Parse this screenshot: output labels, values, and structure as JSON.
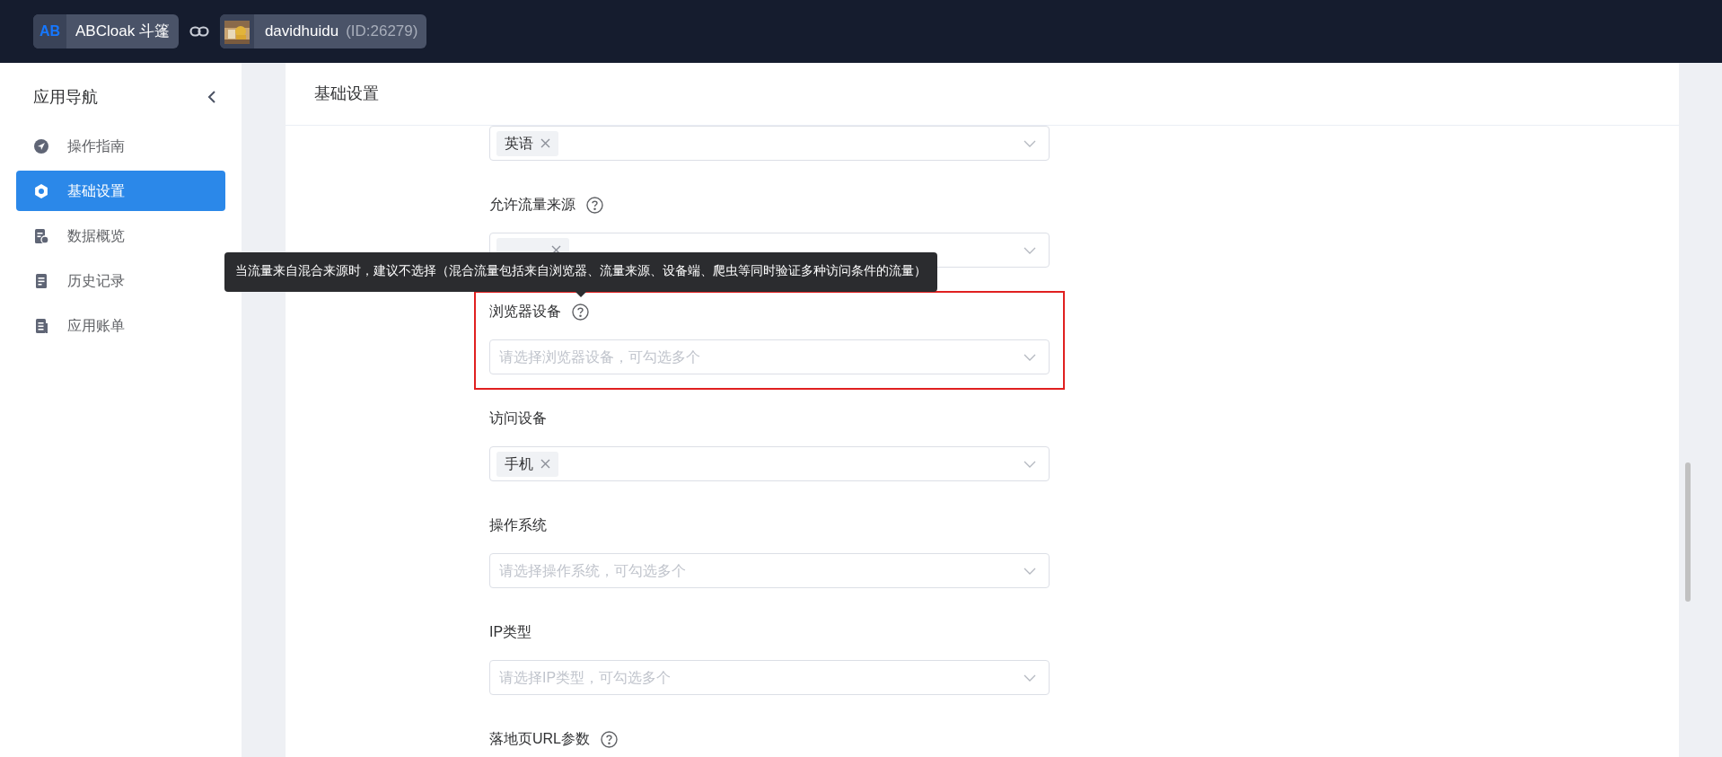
{
  "header": {
    "app": {
      "logo": "AB",
      "name": "ABCloak 斗篷"
    },
    "account": {
      "name": "davidhuidu",
      "id": "(ID:26279)"
    }
  },
  "sidebar": {
    "title": "应用导航",
    "items": [
      {
        "label": "操作指南",
        "selected": false
      },
      {
        "label": "基础设置",
        "selected": true
      },
      {
        "label": "数据概览",
        "selected": false
      },
      {
        "label": "历史记录",
        "selected": false
      },
      {
        "label": "应用账单",
        "selected": false
      }
    ]
  },
  "card": {
    "title": "基础设置",
    "fields": [
      {
        "tags": [
          "英语"
        ],
        "highlighted": false
      },
      {
        "label": "允许流量来源",
        "help": true,
        "tag_covered": true,
        "highlighted": false
      },
      {
        "label": "浏览器设备",
        "help": true,
        "placeholder": "请选择浏览器设备，可勾选多个",
        "highlighted": true,
        "tooltip": "当流量来自混合来源时，建议不选择（混合流量包括来自浏览器、流量来源、设备端、爬虫等同时验证多种访问条件的流量）"
      },
      {
        "label": "访问设备",
        "help": false,
        "tags": [
          "手机"
        ],
        "highlighted": false
      },
      {
        "label": "操作系统",
        "help": false,
        "placeholder": "请选择操作系统，可勾选多个",
        "highlighted": false
      },
      {
        "label": "IP类型",
        "help": false,
        "placeholder": "请选择IP类型，可勾选多个",
        "highlighted": false
      },
      {
        "label": "落地页URL参数",
        "help": true,
        "highlighted": false
      }
    ]
  }
}
